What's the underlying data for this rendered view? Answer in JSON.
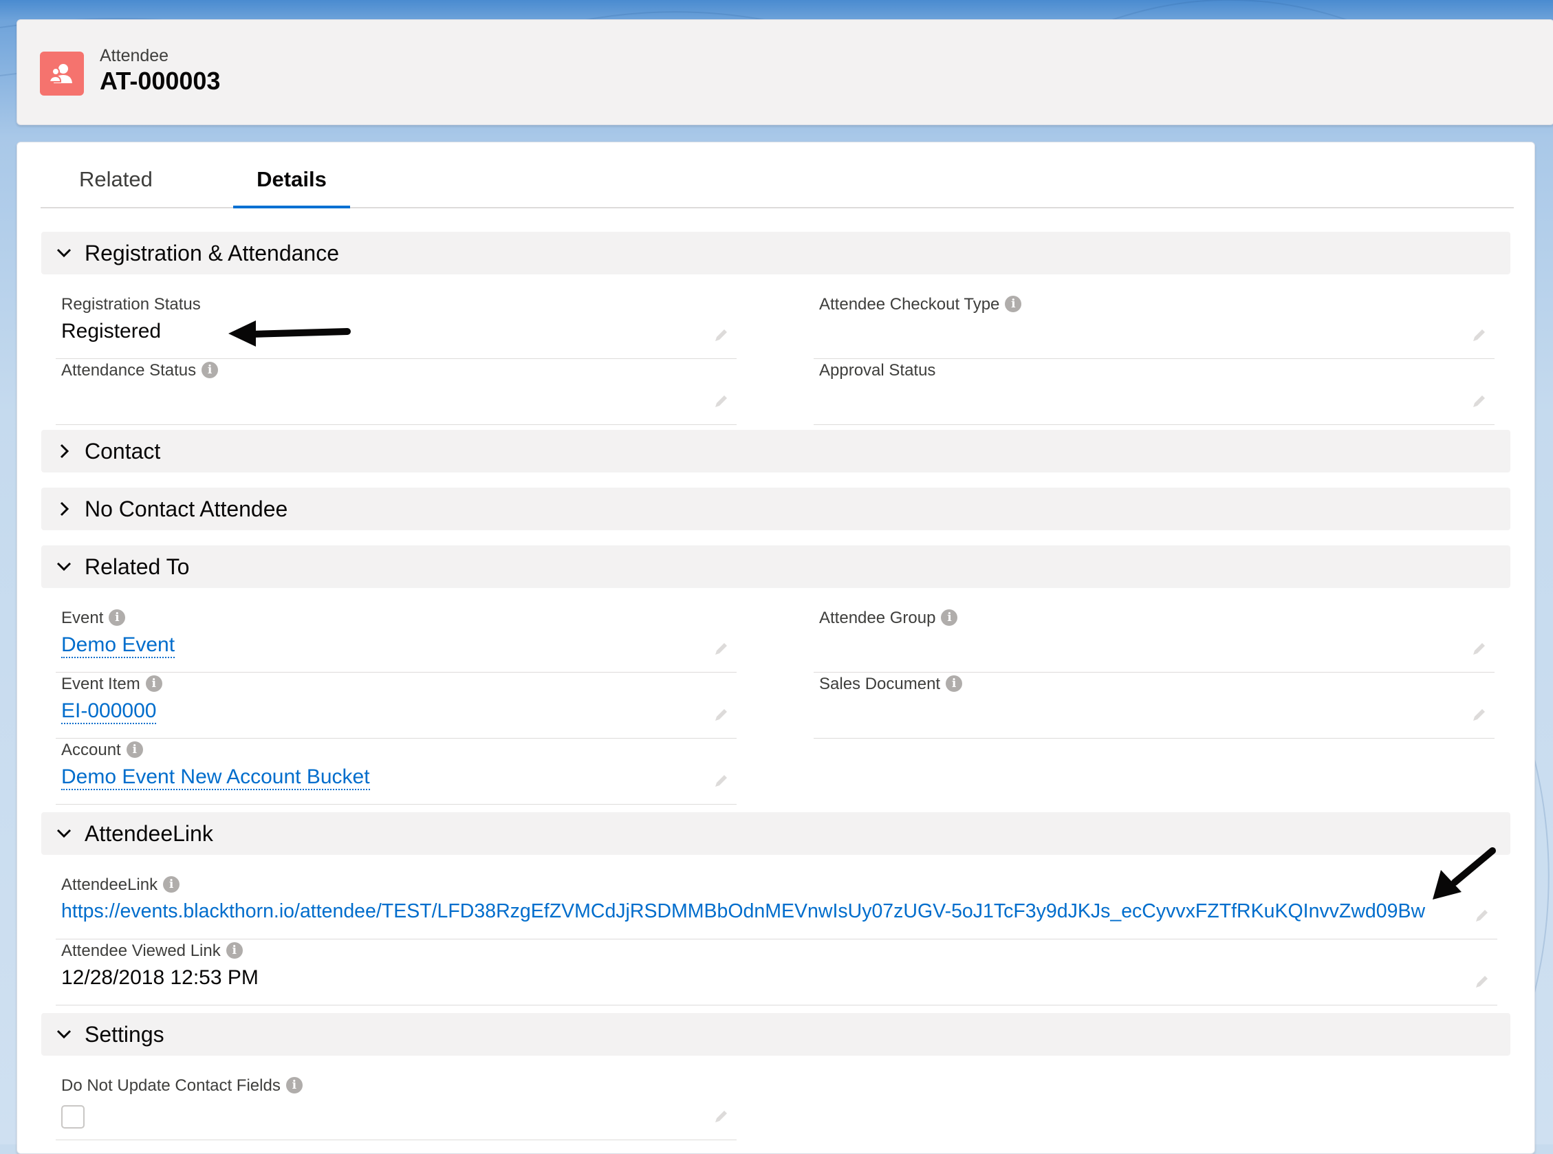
{
  "header": {
    "object_type": "Attendee",
    "record_name": "AT-000003",
    "icon": "attendee-icon"
  },
  "tabs": [
    {
      "label": "Related",
      "active": false
    },
    {
      "label": "Details",
      "active": true
    }
  ],
  "sections": {
    "registration": {
      "title": "Registration & Attendance",
      "expanded": true,
      "fields": {
        "registration_status": {
          "label": "Registration Status",
          "value": "Registered"
        },
        "attendee_checkout_type": {
          "label": "Attendee Checkout Type",
          "value": ""
        },
        "attendance_status": {
          "label": "Attendance Status",
          "value": ""
        },
        "approval_status": {
          "label": "Approval Status",
          "value": ""
        }
      }
    },
    "contact": {
      "title": "Contact",
      "expanded": false
    },
    "no_contact_attendee": {
      "title": "No Contact Attendee",
      "expanded": false
    },
    "related_to": {
      "title": "Related To",
      "expanded": true,
      "fields": {
        "event": {
          "label": "Event",
          "value": "Demo Event"
        },
        "attendee_group": {
          "label": "Attendee Group",
          "value": ""
        },
        "event_item": {
          "label": "Event Item",
          "value": "EI-000000"
        },
        "sales_document": {
          "label": "Sales Document",
          "value": ""
        },
        "account": {
          "label": "Account",
          "value": "Demo Event New Account Bucket"
        }
      }
    },
    "attendee_link": {
      "title": "AttendeeLink",
      "expanded": true,
      "fields": {
        "attendee_link": {
          "label": "AttendeeLink",
          "value": "https://events.blackthorn.io/attendee/TEST/LFD38RzgEfZVMCdJjRSDMMBbOdnMEVnwIsUy07zUGV-5oJ1TcF3y9dJKJs_ecCyvvxFZTfRKuKQInvvZwd09Bw"
        },
        "attendee_viewed_link": {
          "label": "Attendee Viewed Link",
          "value": "12/28/2018 12:53 PM"
        }
      }
    },
    "settings": {
      "title": "Settings",
      "expanded": true,
      "fields": {
        "do_not_update_contact_fields": {
          "label": "Do Not Update Contact Fields",
          "checked": false
        }
      }
    }
  },
  "colors": {
    "link": "#006dcc",
    "tab_active_underline": "#0070d2",
    "attendee_icon_bg": "#f5736e",
    "section_header_bg": "#f3f2f2"
  }
}
